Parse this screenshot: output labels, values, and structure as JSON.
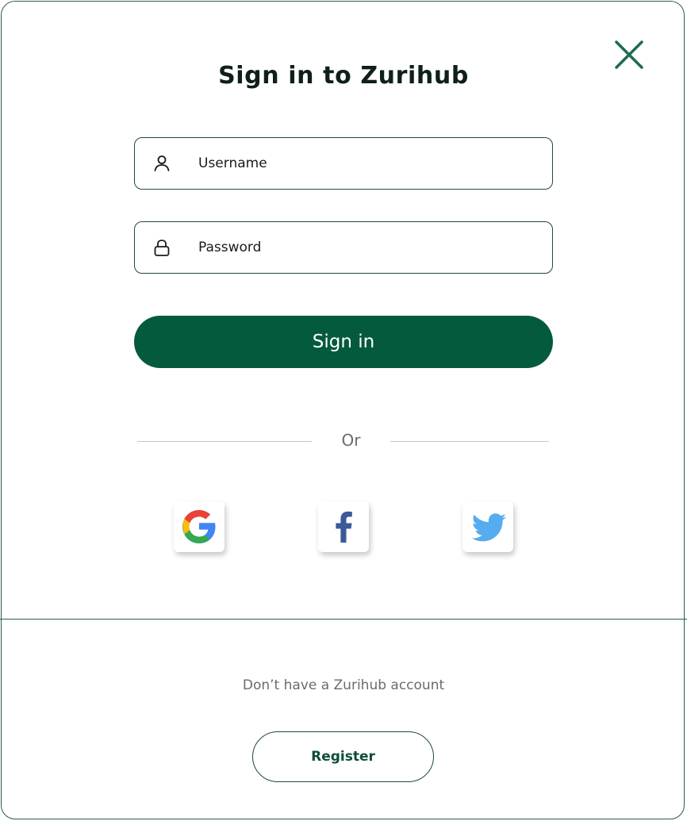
{
  "modal": {
    "title": "Sign in to Zurihub",
    "close_icon": "close-icon"
  },
  "form": {
    "username": {
      "placeholder": "Username",
      "value": "",
      "icon": "user-icon"
    },
    "password": {
      "placeholder": "Password",
      "value": "",
      "icon": "lock-icon"
    },
    "submit_label": "Sign in"
  },
  "divider": {
    "text": "Or"
  },
  "social": [
    {
      "name": "Google",
      "icon": "google-icon"
    },
    {
      "name": "Facebook",
      "icon": "facebook-icon"
    },
    {
      "name": "Twitter",
      "icon": "twitter-icon"
    }
  ],
  "footer": {
    "prompt": "Don’t have a Zurihub account",
    "register_label": "Register"
  },
  "colors": {
    "primary": "#045a3c",
    "border": "#1f4a3a",
    "muted_text": "#6b6b6b",
    "google_blue": "#4285F4",
    "google_red": "#EA4335",
    "google_yellow": "#FBBC05",
    "google_green": "#34A853",
    "facebook": "#3b5998",
    "twitter": "#55acee"
  }
}
